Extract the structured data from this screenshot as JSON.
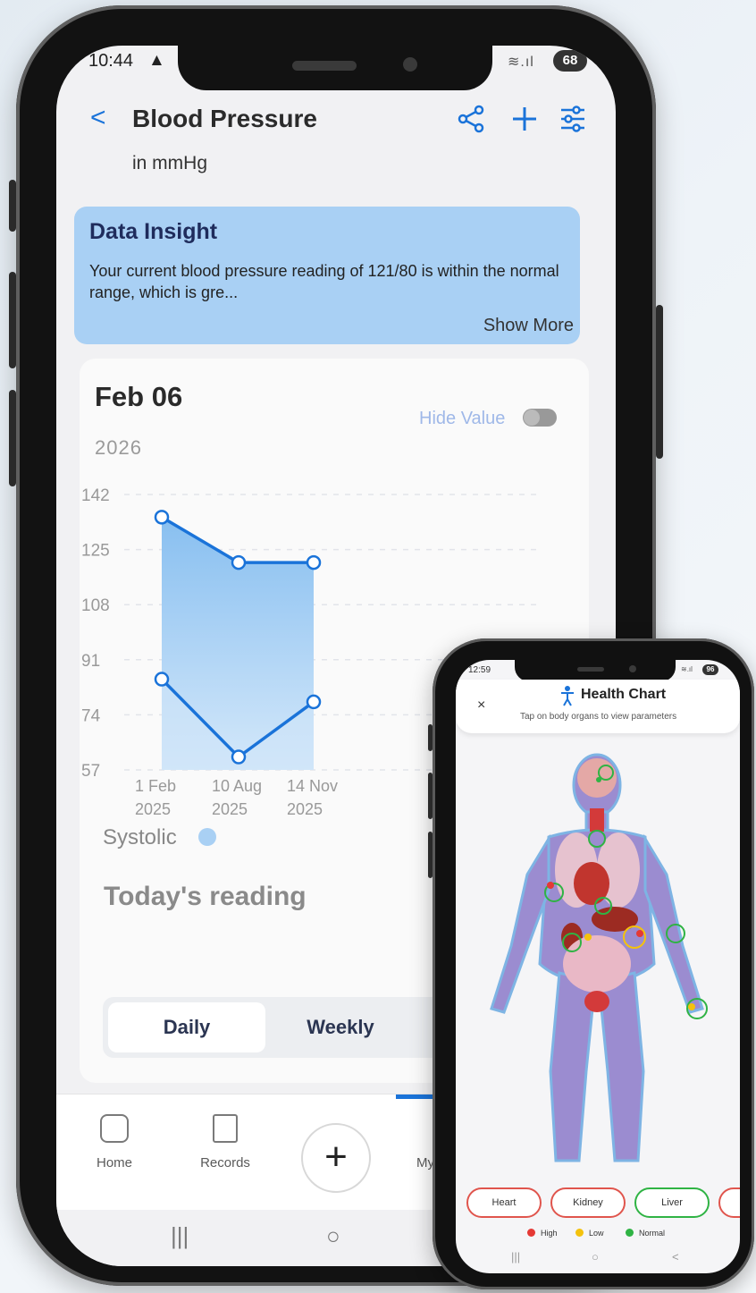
{
  "main_app": {
    "status": {
      "time": "10:44",
      "alert_glyph": "▲",
      "signal": "≋.ıl",
      "battery": "68"
    },
    "header": {
      "title": "Blood Pressure",
      "subtitle": "in mmHg",
      "back_glyph": "<"
    },
    "insight": {
      "title": "Data Insight",
      "body": "Your current blood pressure reading of 121/80 is within the normal range, which is gre...",
      "show_more": "Show More"
    },
    "card": {
      "date": "Feb 06",
      "year": "2026",
      "hide_value_label": "Hide Value",
      "legend_label": "Systolic",
      "today_label": "Today's reading",
      "periods": [
        "Daily",
        "Weekly"
      ]
    },
    "nav": {
      "home": "Home",
      "records": "Records",
      "partial": "My",
      "fab": "+"
    },
    "system_nav": {
      "recent": "|||",
      "home": "○"
    },
    "colors": {
      "accent": "#1a73d9",
      "insight_bg": "#a9d0f4",
      "chart_fill": "#a9d0f4"
    }
  },
  "chart_data": {
    "type": "area",
    "title": "",
    "xlabel": "",
    "ylabel": "",
    "categories": [
      "1 Feb 2025",
      "10 Aug 2025",
      "14 Nov 2025"
    ],
    "category_lines": [
      [
        "1 Feb",
        "2025"
      ],
      [
        "10 Aug",
        "2025"
      ],
      [
        "14 Nov",
        "2025"
      ]
    ],
    "series": [
      {
        "values": [
          135,
          121,
          121
        ]
      },
      {
        "values": [
          85,
          61,
          78
        ]
      }
    ],
    "y_ticks": [
      142,
      125,
      108,
      91,
      74,
      57
    ],
    "ylim": [
      57,
      142
    ],
    "grid": true,
    "legend": "bottom-left"
  },
  "health_app": {
    "status": {
      "time": "12:59",
      "signal": "≋.ıl",
      "battery": "96"
    },
    "header": {
      "close": "×",
      "title": "Health Chart",
      "subtitle": "Tap on body organs to view parameters"
    },
    "organs": [
      "Heart",
      "Kidney",
      "Liver"
    ],
    "legend": [
      {
        "label": "High",
        "color": "#e53935"
      },
      {
        "label": "Low",
        "color": "#f4c20d"
      },
      {
        "label": "Normal",
        "color": "#2fb344"
      }
    ],
    "system_nav": {
      "recent": "|||",
      "home": "○",
      "back": "<"
    }
  }
}
